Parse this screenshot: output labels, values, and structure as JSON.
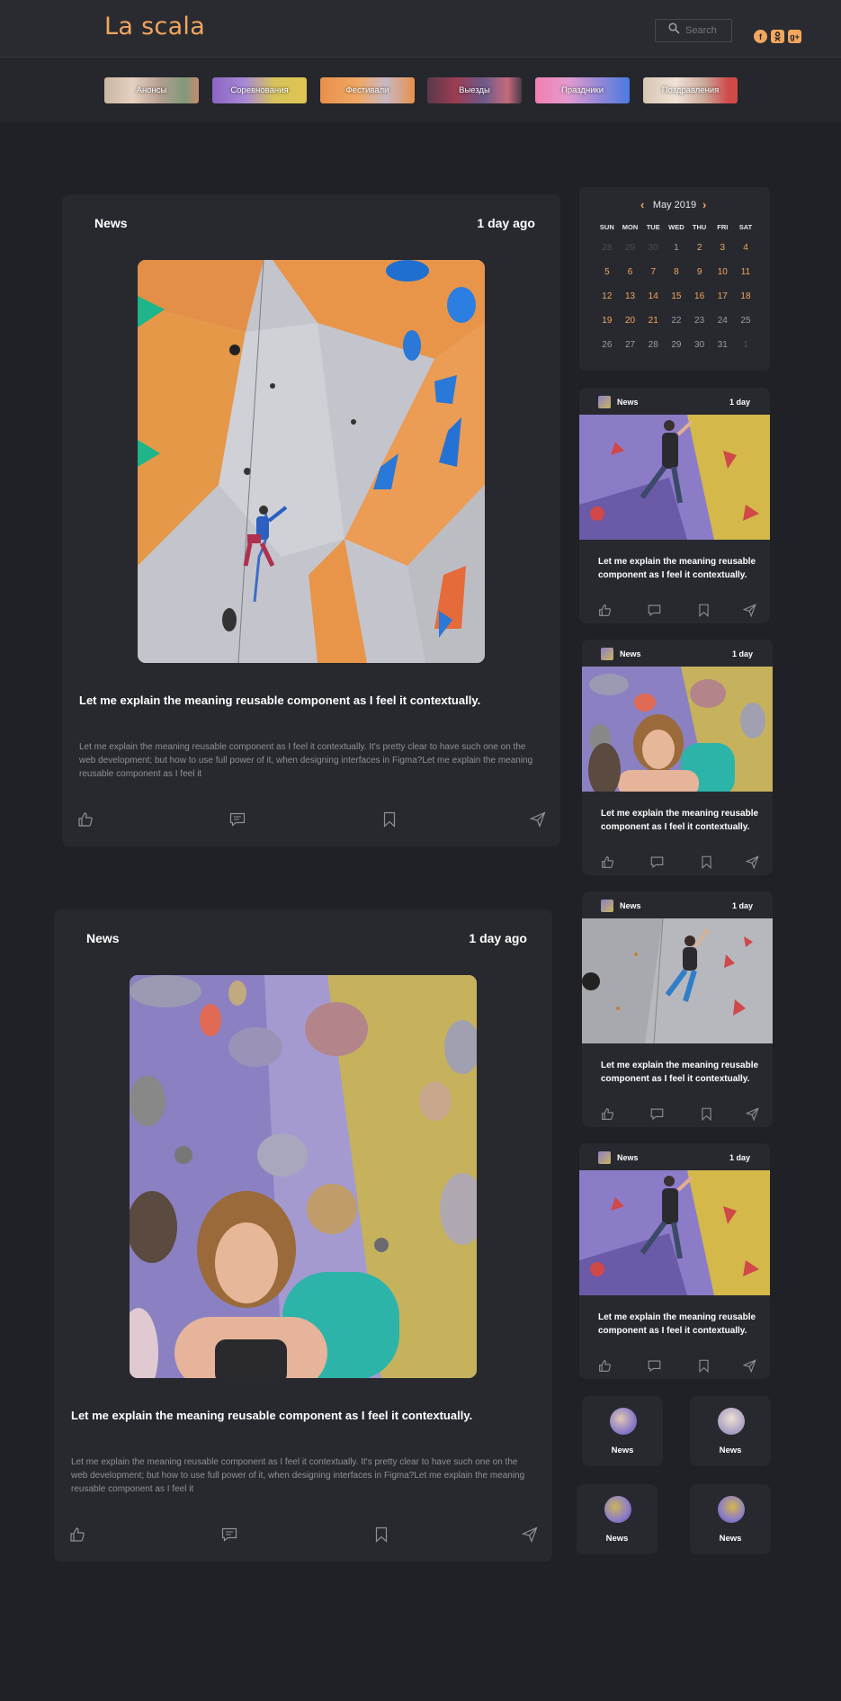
{
  "header": {
    "logo": "La scala",
    "search_placeholder": "Search"
  },
  "categories": [
    "Анонсы",
    "Соревнования",
    "Фестивали",
    "Выезды",
    "Праздники",
    "Поздравления"
  ],
  "posts": [
    {
      "label": "News",
      "time": "1 day ago",
      "title": "Let me explain the meaning reusable component as I feel it contextually.",
      "text": "Let me explain the meaning reusable component as I feel it contextually. It's pretty clear to have such one on the web development; but how to use full power of it, when designing interfaces in Figma?Let me explain the meaning reusable component as I feel it"
    },
    {
      "label": "News",
      "time": "1 day ago",
      "title": "Let me explain the meaning reusable component as I feel it contextually.",
      "text": "Let me explain the meaning reusable component as I feel it contextually. It's pretty clear to have such one on the web development; but how to use full power of it, when designing interfaces in Figma?Let me explain the meaning reusable component as I feel it"
    }
  ],
  "calendar": {
    "month": "May 2019",
    "weekdays": [
      "SUN",
      "MON",
      "TUE",
      "WED",
      "THU",
      "FRI",
      "SAT"
    ]
  },
  "mini_cards": [
    {
      "label": "News",
      "time": "1 day",
      "title": "Let me explain the meaning reusable component as I feel it contextually."
    },
    {
      "label": "News",
      "time": "1 day",
      "title": "Let me explain the meaning reusable component as I feel it contextually."
    },
    {
      "label": "News",
      "time": "1 day",
      "title": "Let me explain the meaning reusable component as I feel it contextually."
    },
    {
      "label": "News",
      "time": "1 day",
      "title": "Let me explain the meaning reusable component as I feel it contextually."
    }
  ],
  "tiles": [
    {
      "label": "News"
    },
    {
      "label": "News"
    },
    {
      "label": "News"
    },
    {
      "label": "News"
    }
  ],
  "colors": {
    "accent": "#f2a65e",
    "background": "#1f2126",
    "card": "#27292f"
  },
  "icons": [
    "search-icon",
    "facebook-icon",
    "odnoklassniki-icon",
    "google-plus-icon",
    "chevron-left-icon",
    "chevron-right-icon",
    "like-icon",
    "comment-icon",
    "bookmark-icon",
    "share-icon"
  ]
}
